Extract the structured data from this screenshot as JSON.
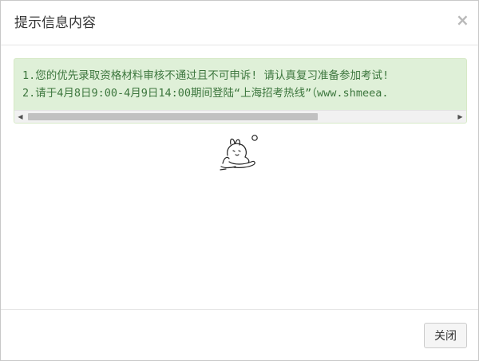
{
  "dialog": {
    "title": "提示信息内容",
    "close_symbol": "×",
    "close_icon": "close-icon"
  },
  "notice": {
    "lines": [
      "1.您的优先录取资格材料审核不通过且不可申诉! 请认真复习准备参加考试!",
      "2.请于4月8日9:00-4月9日14:00期间登陆“上海招考热线”（www.shmeea."
    ],
    "background_color": "#dff0d8",
    "text_color": "#3c763d"
  },
  "scrollbar": {
    "left_arrow": "◀",
    "right_arrow": "▶"
  },
  "emoticon": {
    "icon": "sad-bunny-emoticon-icon"
  },
  "footer": {
    "close_label": "关闭"
  }
}
